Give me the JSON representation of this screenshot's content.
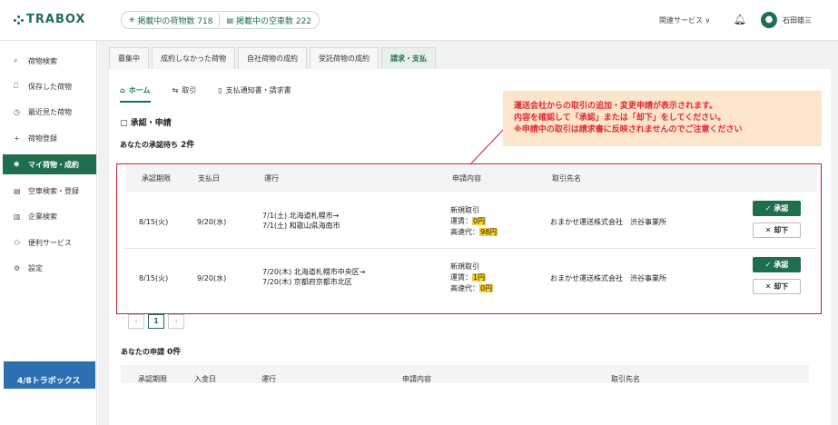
{
  "app": {
    "logo": "TRABOX"
  },
  "header": {
    "stat1": "掲載中の荷物数 718",
    "stat2": "掲載中の空車数 222",
    "related": "関連サービス ∨",
    "user": "石田雄三",
    "avatar_initial": "👤"
  },
  "sidebar": {
    "items": [
      {
        "icon": "⌕",
        "label": "荷物検索"
      },
      {
        "icon": "⎕",
        "label": "保存した荷物"
      },
      {
        "icon": "◷",
        "label": "最近見た荷物"
      },
      {
        "icon": "+",
        "label": "荷物登録"
      },
      {
        "icon": "⎈",
        "label": "マイ荷物・成約"
      },
      {
        "icon": "▤",
        "label": "空車検索・登録"
      },
      {
        "icon": "▥",
        "label": "企業検索"
      },
      {
        "icon": "⚇",
        "label": "便利サービス"
      },
      {
        "icon": "⚙",
        "label": "設定"
      }
    ],
    "promo": "4/8トラボックス"
  },
  "tabs": [
    "募集中",
    "成約しなかった荷物",
    "自社荷物の成約",
    "受託荷物の成約",
    "請求・支払"
  ],
  "subtabs": [
    "ホーム",
    "取引",
    "支払通知書・請求書"
  ],
  "section_title": "承認・申請",
  "pending": {
    "label": "あなたの承認待ち",
    "count": "2件"
  },
  "table": {
    "headers": [
      "承認期限",
      "支払日",
      "運行",
      "申請内容",
      "取引先名"
    ],
    "rows": [
      {
        "deadline": "8/15(火)",
        "payday": "9/20(水)",
        "route1": "7/1(土) 北海道札幌市→",
        "route2": "7/1(土) 和歌山県海南市",
        "req_type": "新規取引",
        "fare_label": "運賃：",
        "fare": "0円",
        "toll_label": "高速代：",
        "toll": "98円",
        "partner": "おまかせ運送株式会社　渋谷事業所"
      },
      {
        "deadline": "8/15(火)",
        "payday": "9/20(水)",
        "route1": "7/20(木) 北海道札幌市中央区→",
        "route2": "7/20(木) 京都府京都市北区",
        "req_type": "新規取引",
        "fare_label": "運賃：",
        "fare": "1円",
        "toll_label": "高速代：",
        "toll": "0円",
        "partner": "おまかせ運送株式会社　渋谷事業所"
      }
    ],
    "approve": "✓ 承認",
    "reject": "✕ 却下"
  },
  "pager": {
    "prev": "‹",
    "current": "1",
    "next": "›"
  },
  "yours": {
    "label": "あなたの申請",
    "count": "0件"
  },
  "table2": {
    "headers": [
      "承認期限",
      "入金日",
      "運行",
      "申請内容",
      "取引先名"
    ]
  },
  "callout": {
    "line1": "運送会社からの取引の追加・変更申請が表示されます。",
    "line2": "内容を確認して「承認」または「却下」をしてください。",
    "line3": "※申請中の取引は請求書に反映されませんのでご注意ください"
  },
  "colors": {
    "brand": "#1f6e4d",
    "highlight": "#c0232e",
    "callout_bg": "#fde5cc",
    "mark": "#f7d031"
  }
}
